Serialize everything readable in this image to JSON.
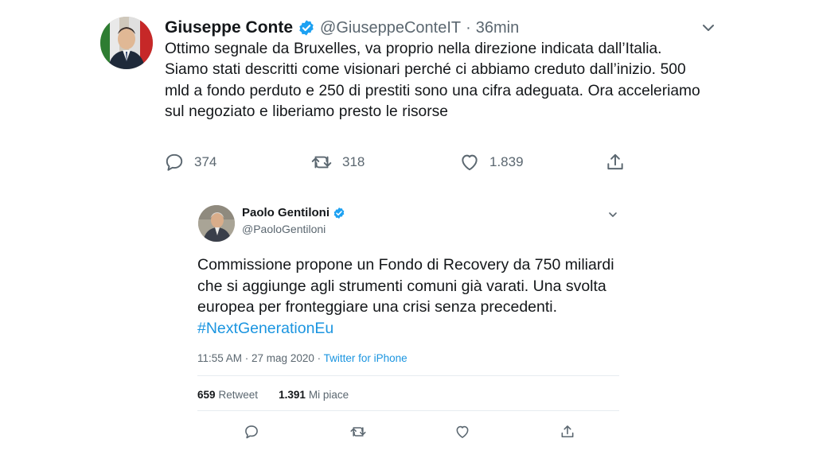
{
  "main_tweet": {
    "author_name": "Giuseppe Conte",
    "handle": "@GiuseppeConteIT",
    "separator": "·",
    "time": "36min",
    "text": "Ottimo segnale da Bruxelles, va proprio nella direzione indicata dall’Italia. Siamo stati descritti come visionari perché ci abbiamo creduto dall’inizio. 500 mld a fondo perduto e 250 di prestiti sono una cifra adeguata. Ora acceleriamo sul negoziato e liberiamo presto le risorse",
    "replies": "374",
    "retweets": "318",
    "likes": "1.839",
    "verified_color": "#1da1f2",
    "icons": [
      "reply-icon",
      "retweet-icon",
      "like-icon",
      "share-icon",
      "chevron-down-icon"
    ]
  },
  "quoted_tweet": {
    "author_name": "Paolo Gentiloni",
    "handle": "@PaoloGentiloni",
    "text": "Commissione propone un Fondo di Recovery da 750 miliardi che si aggiunge agli strumenti comuni già varati. Una svolta europea per fronteggiare una crisi senza precedenti. ",
    "hashtag": "#NextGenerationEu",
    "timestamp": "11:55 AM · 27 mag 2020 · ",
    "source": "Twitter for iPhone",
    "retweet_count": "659",
    "retweet_label": "Retweet",
    "like_count": "1.391",
    "like_label": "Mi piace",
    "link_color": "#1b95e0"
  }
}
